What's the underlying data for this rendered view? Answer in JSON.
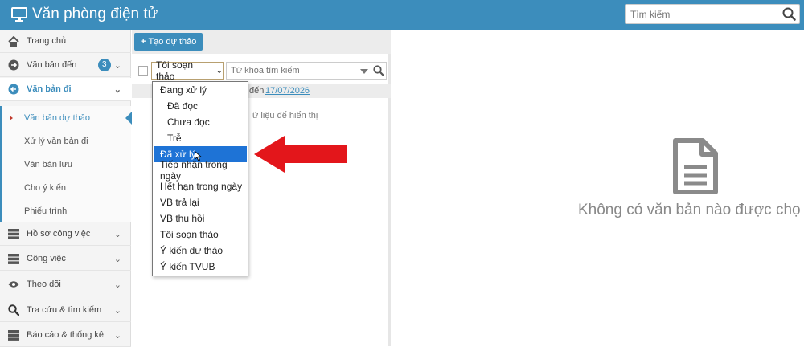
{
  "app": {
    "title": "Văn phòng điện tử"
  },
  "search": {
    "placeholder": "Tìm kiếm"
  },
  "sidebar": {
    "items": [
      {
        "label": "Trang chủ"
      },
      {
        "label": "Văn bản đến",
        "badge": "3"
      },
      {
        "label": "Văn bản đi"
      },
      {
        "label": "Hồ sơ công việc"
      },
      {
        "label": "Công việc"
      },
      {
        "label": "Theo dõi"
      },
      {
        "label": "Tra cứu & tìm kiếm"
      },
      {
        "label": "Báo cáo & thống kê"
      }
    ],
    "subitems": [
      {
        "label": "Văn bản dự thảo"
      },
      {
        "label": "Xử lý văn bản đi"
      },
      {
        "label": "Văn bản lưu"
      },
      {
        "label": "Cho ý kiến"
      },
      {
        "label": "Phiếu trình"
      }
    ]
  },
  "toolbar": {
    "create_label": "Tạo dự thảo"
  },
  "filter": {
    "selected": "Tôi soạn thảo",
    "keyword_placeholder": "Từ khóa tìm kiếm",
    "date_label": "đến",
    "date_value": "17/07/2026",
    "no_data": "ữ liệu để hiển thị"
  },
  "dropdown": {
    "options": [
      "Đang xử lý",
      "Đã đọc",
      "Chưa đọc",
      "Trễ",
      "Đã xử lý",
      "Tiếp nhận trong ngày",
      "Hết hạn trong ngày",
      "VB trả lại",
      "VB thu hồi",
      "Tôi soạn thảo",
      "Ý kiến dự thảo",
      "Ý kiến TVUB"
    ],
    "highlighted": "Đã xử lý"
  },
  "right": {
    "empty_message": "Không có văn bản nào được chọ"
  },
  "colors": {
    "header": "#3c8dbc",
    "highlight": "#1e73d6",
    "arrow": "#e3161b"
  }
}
